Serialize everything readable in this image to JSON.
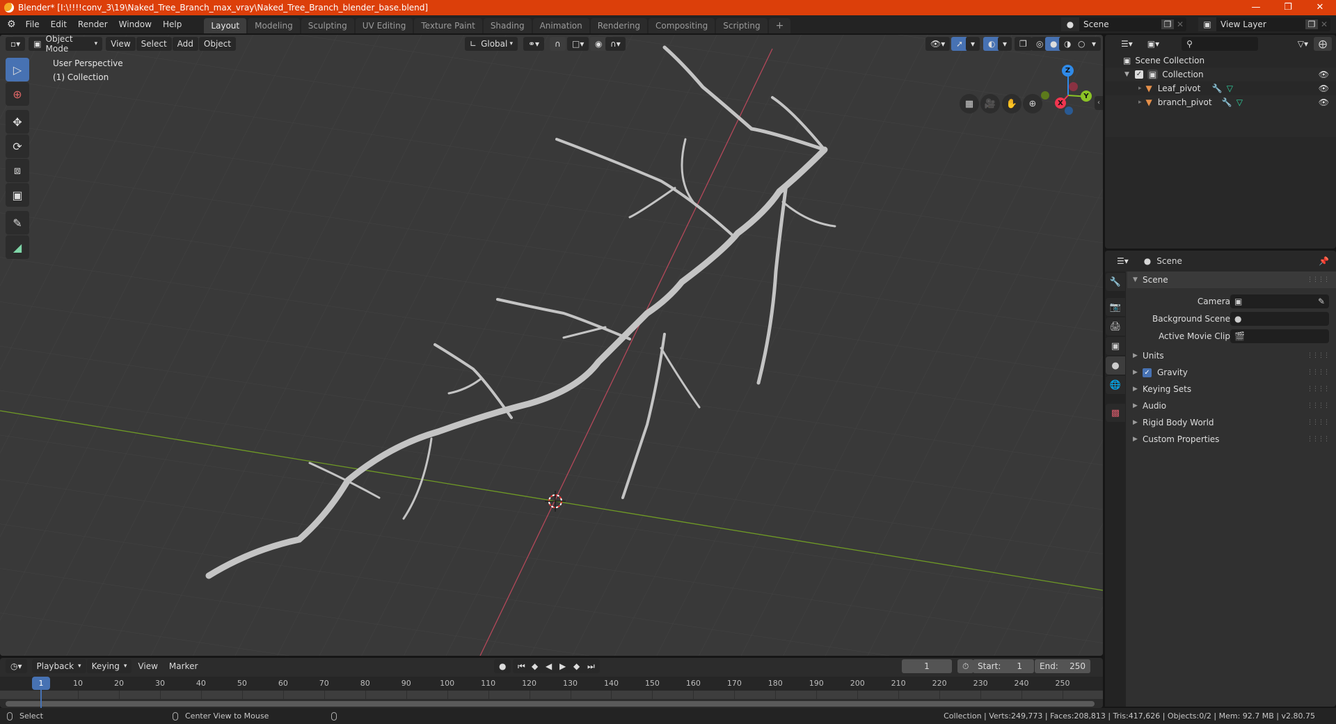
{
  "window": {
    "title": "Blender* [I:\\!!!!conv_3\\19\\Naked_Tree_Branch_max_vray\\Naked_Tree_Branch_blender_base.blend]",
    "controls": [
      "minimize",
      "restore",
      "close"
    ]
  },
  "topbar": {
    "menus": [
      "File",
      "Edit",
      "Render",
      "Window",
      "Help"
    ],
    "workspaces": [
      "Layout",
      "Modeling",
      "Sculpting",
      "UV Editing",
      "Texture Paint",
      "Shading",
      "Animation",
      "Rendering",
      "Compositing",
      "Scripting"
    ],
    "active_workspace": "Layout",
    "add_workspace": "+",
    "scene": "Scene",
    "view_layer": "View Layer"
  },
  "viewport": {
    "mode": "Object Mode",
    "menus": [
      "View",
      "Select",
      "Add",
      "Object"
    ],
    "orientation": "Global",
    "info_line1": "User Perspective",
    "info_line2": "(1) Collection",
    "tools": [
      "select-box",
      "cursor",
      "move",
      "rotate",
      "scale",
      "transform",
      "annotate",
      "measure"
    ],
    "active_tool": "select-box",
    "nav_buttons": [
      "grid-view-icon",
      "camera-view-icon",
      "pan-hand-icon",
      "zoom-icon"
    ],
    "gizmo": {
      "x": "X",
      "y": "Y",
      "z": "Z",
      "x_color": "#f0354f",
      "y_color": "#8bc326",
      "z_color": "#2f8ae8"
    },
    "axis_colors": {
      "x_axis": "#b4485a",
      "y_axis": "#6f9a25"
    },
    "object_color": "#bdbdbd"
  },
  "outliner": {
    "root": "Scene Collection",
    "collection": "Collection",
    "objects": [
      {
        "name": "Leaf_pivot",
        "has_modifier": true,
        "has_mesh": true
      },
      {
        "name": "branch_pivot",
        "has_modifier": true,
        "has_mesh": true
      }
    ]
  },
  "properties": {
    "context": "Scene",
    "panel_title": "Scene",
    "fields": [
      {
        "label": "Camera",
        "value": ""
      },
      {
        "label": "Background Scene",
        "value": ""
      },
      {
        "label": "Active Movie Clip",
        "value": ""
      }
    ],
    "subpanels": [
      {
        "label": "Units",
        "checkbox": false
      },
      {
        "label": "Gravity",
        "checkbox": true,
        "checked": true
      },
      {
        "label": "Keying Sets",
        "checkbox": false
      },
      {
        "label": "Audio",
        "checkbox": false
      },
      {
        "label": "Rigid Body World",
        "checkbox": false
      },
      {
        "label": "Custom Properties",
        "checkbox": false
      }
    ]
  },
  "timeline": {
    "menus": [
      "Playback",
      "Keying",
      "View",
      "Marker"
    ],
    "current_frame": "1",
    "start_label": "Start:",
    "start": "1",
    "end_label": "End:",
    "end": "250",
    "ticks": [
      "10",
      "20",
      "30",
      "40",
      "50",
      "60",
      "70",
      "80",
      "90",
      "100",
      "110",
      "120",
      "130",
      "140",
      "150",
      "160",
      "170",
      "180",
      "190",
      "200",
      "210",
      "220",
      "230",
      "240",
      "250"
    ],
    "frame_indicator": "1"
  },
  "statusbar": {
    "left_action": "Select",
    "middle_action": "Center View to Mouse",
    "stats": "Collection | Verts:249,773 | Faces:208,813 | Tris:417,626 | Objects:0/2 | Mem: 92.7 MB | v2.80.75"
  }
}
